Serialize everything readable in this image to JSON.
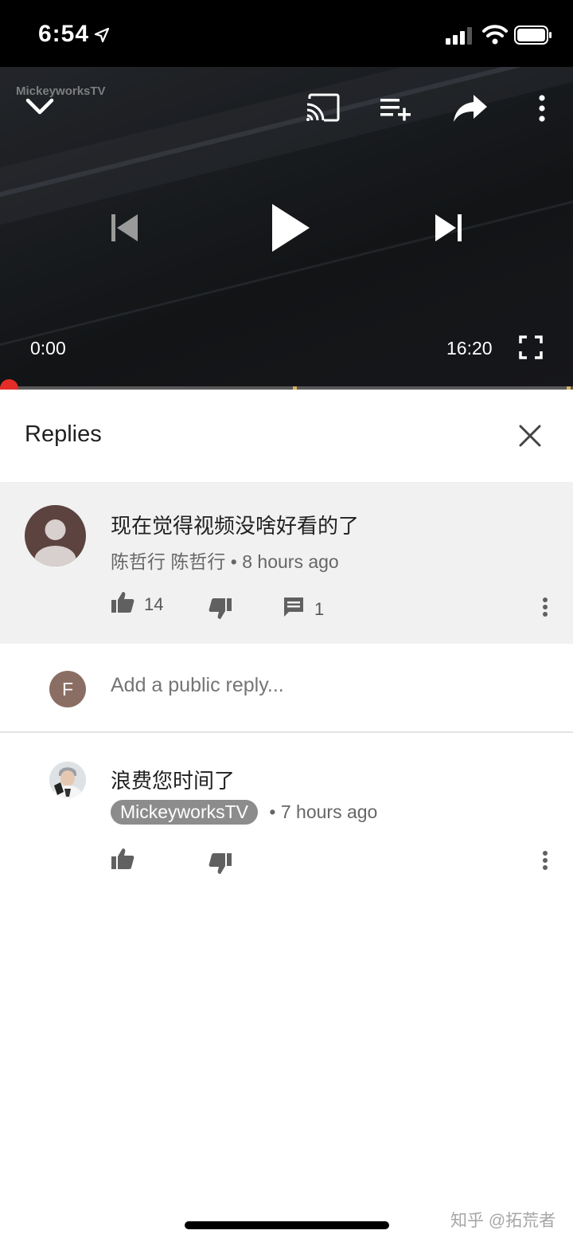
{
  "status_bar": {
    "time": "6:54"
  },
  "player": {
    "watermark": "MickeyworksTV",
    "current_time": "0:00",
    "duration": "16:20",
    "progress_fraction": 0.0,
    "icons": [
      "chevron-down-icon",
      "cast-icon",
      "add-to-playlist-icon",
      "share-icon",
      "more-vert-icon",
      "previous-icon",
      "play-icon",
      "next-icon",
      "fullscreen-icon"
    ]
  },
  "replies_header": {
    "title": "Replies"
  },
  "parent_comment": {
    "text": "现在觉得视频没啥好看的了",
    "author": "陈哲行 陈哲行",
    "time": "• 8 hours ago",
    "likes": "14",
    "replies": "1"
  },
  "add_reply": {
    "avatar_letter": "F",
    "placeholder": "Add a public reply..."
  },
  "reply": {
    "text": "浪费您时间了",
    "author": "MickeyworksTV",
    "time": "• 7 hours ago"
  },
  "watermark_corner": "知乎 @拓荒者",
  "colors": {
    "progress_red": "#e52d27",
    "background_gray": "#f1f1f1",
    "chip_gray": "#8c8c8c"
  }
}
